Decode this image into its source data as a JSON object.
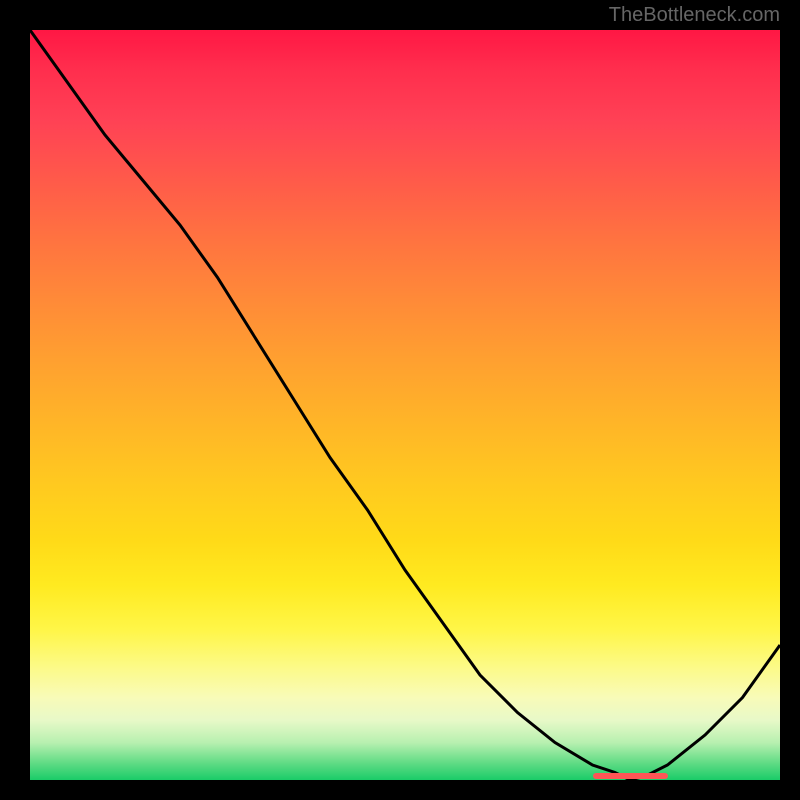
{
  "watermark": "TheBottleneck.com",
  "chart_data": {
    "type": "line",
    "title": "",
    "xlabel": "",
    "ylabel": "",
    "x": [
      0,
      5,
      10,
      15,
      20,
      25,
      30,
      35,
      40,
      45,
      50,
      55,
      60,
      65,
      70,
      75,
      78,
      80,
      82,
      85,
      90,
      95,
      100
    ],
    "values": [
      100,
      93,
      86,
      80,
      74,
      67,
      59,
      51,
      43,
      36,
      28,
      21,
      14,
      9,
      5,
      2,
      1,
      0,
      0.5,
      2,
      6,
      11,
      18
    ],
    "ylim": [
      0,
      100
    ],
    "xlim": [
      0,
      100
    ],
    "minimum_zone": {
      "start": 75,
      "end": 85
    },
    "gradient_colors": {
      "top": "#ff1744",
      "mid_upper": "#ff8a38",
      "mid": "#ffda18",
      "mid_lower": "#fcfa88",
      "bottom": "#1acc68"
    }
  }
}
